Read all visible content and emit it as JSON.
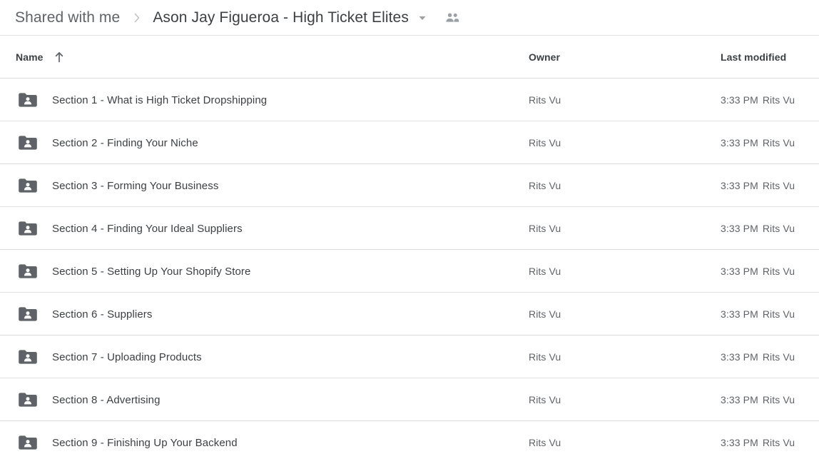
{
  "breadcrumb": {
    "parent_label": "Shared with me",
    "separator_icon": "chevron-right-icon",
    "current_label": "Ason Jay Figueroa - High Ticket Elites",
    "caret_icon": "chevron-down-icon",
    "people_icon": "people-shared-icon"
  },
  "columns": {
    "name": "Name",
    "sort_icon": "arrow-up-icon",
    "owner": "Owner",
    "last_modified": "Last modified"
  },
  "colors": {
    "text_primary": "#3c4043",
    "text_secondary": "#5f6368",
    "divider": "#e0e0e0",
    "folder_icon": "#5f6368",
    "background": "#ffffff"
  },
  "rows": [
    {
      "icon": "shared-folder-icon",
      "name": "Section 1 - What is High Ticket Dropshipping",
      "owner": "Rits Vu",
      "modified_time": "3:33 PM",
      "modified_by": "Rits Vu"
    },
    {
      "icon": "shared-folder-icon",
      "name": "Section 2 - Finding Your Niche",
      "owner": "Rits Vu",
      "modified_time": "3:33 PM",
      "modified_by": "Rits Vu"
    },
    {
      "icon": "shared-folder-icon",
      "name": "Section 3 - Forming Your Business",
      "owner": "Rits Vu",
      "modified_time": "3:33 PM",
      "modified_by": "Rits Vu"
    },
    {
      "icon": "shared-folder-icon",
      "name": "Section 4 - Finding Your Ideal Suppliers",
      "owner": "Rits Vu",
      "modified_time": "3:33 PM",
      "modified_by": "Rits Vu"
    },
    {
      "icon": "shared-folder-icon",
      "name": "Section 5 - Setting Up Your Shopify Store",
      "owner": "Rits Vu",
      "modified_time": "3:33 PM",
      "modified_by": "Rits Vu"
    },
    {
      "icon": "shared-folder-icon",
      "name": "Section 6 - Suppliers",
      "owner": "Rits Vu",
      "modified_time": "3:33 PM",
      "modified_by": "Rits Vu"
    },
    {
      "icon": "shared-folder-icon",
      "name": "Section 7 - Uploading Products",
      "owner": "Rits Vu",
      "modified_time": "3:33 PM",
      "modified_by": "Rits Vu"
    },
    {
      "icon": "shared-folder-icon",
      "name": "Section 8 - Advertising",
      "owner": "Rits Vu",
      "modified_time": "3:33 PM",
      "modified_by": "Rits Vu"
    },
    {
      "icon": "shared-folder-icon",
      "name": "Section 9 - Finishing Up Your Backend",
      "owner": "Rits Vu",
      "modified_time": "3:33 PM",
      "modified_by": "Rits Vu"
    }
  ]
}
